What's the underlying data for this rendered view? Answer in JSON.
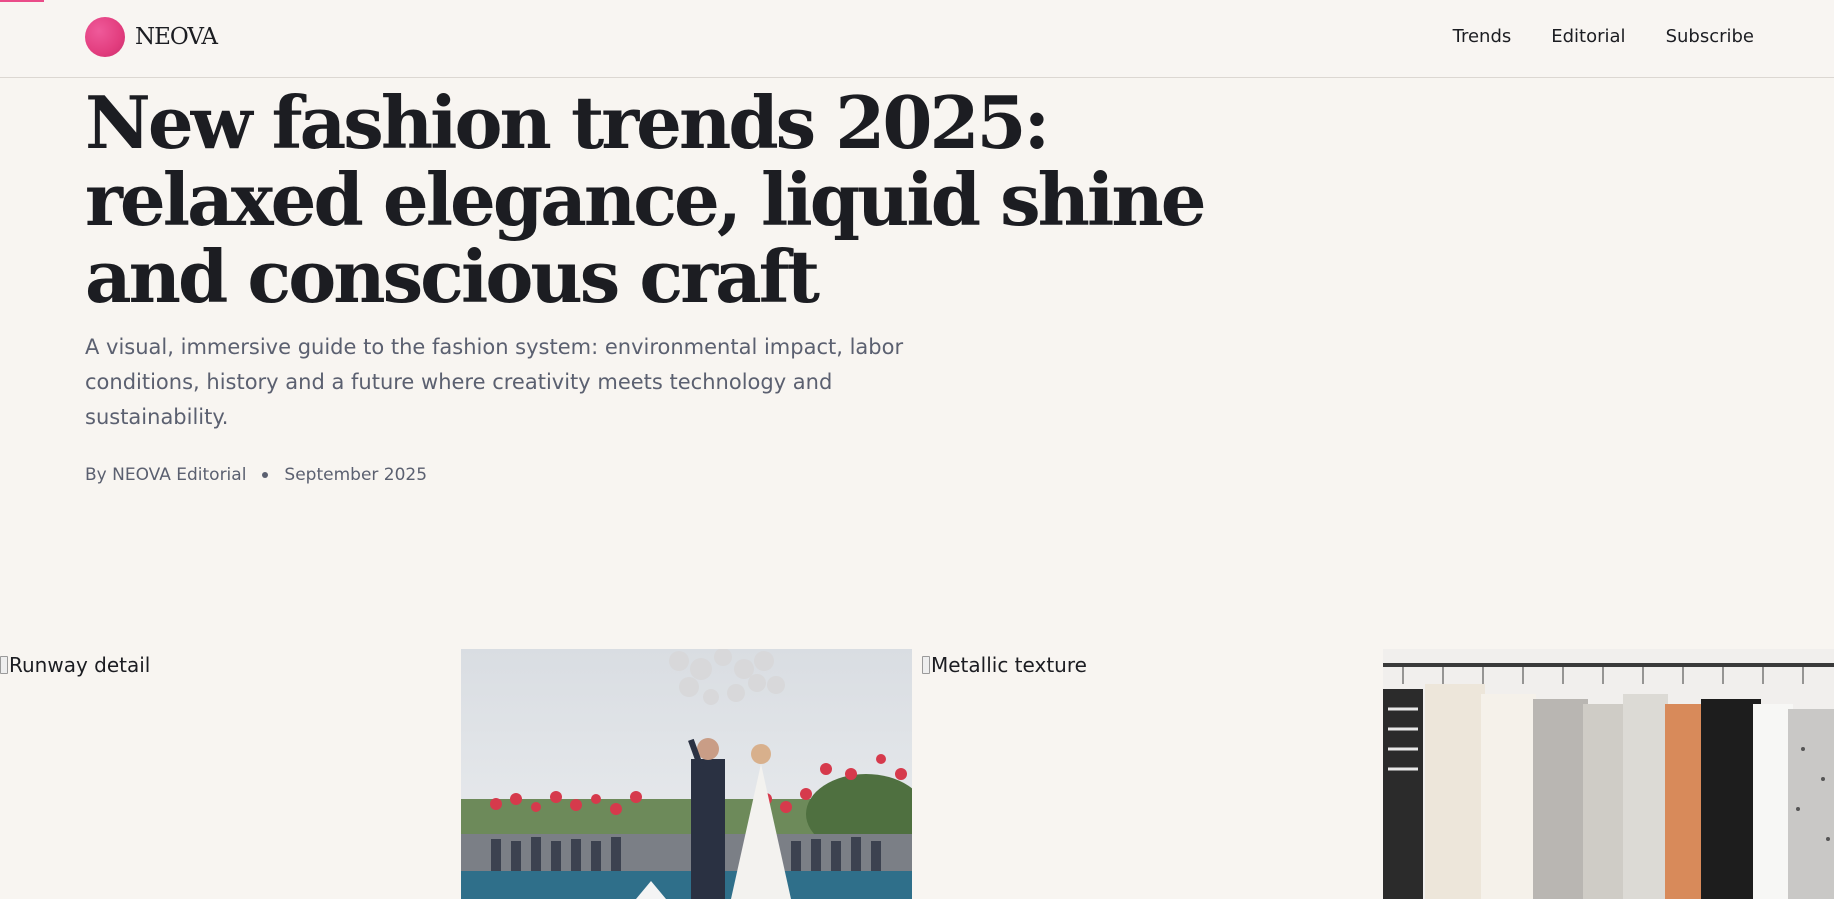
{
  "brand": {
    "name": "NEOVA",
    "accent": "#ea4c89"
  },
  "nav": [
    {
      "label": "Trends"
    },
    {
      "label": "Editorial"
    },
    {
      "label": "Subscribe"
    }
  ],
  "article": {
    "title": "New fashion trends 2025: relaxed elegance, liquid shine and conscious craft",
    "subtitle": "A visual, immersive guide to the fashion system: environmental impact, labor conditions, history and a future where creativity meets technology and sustainability.",
    "author": "By NEOVA Editorial",
    "date": "September 2025"
  },
  "gallery": [
    {
      "alt": "Runway detail",
      "status": "broken"
    },
    {
      "alt": "",
      "status": "loaded",
      "subject": "wedding-balloons-photo"
    },
    {
      "alt": "Metallic texture",
      "status": "broken"
    },
    {
      "alt": "",
      "status": "loaded",
      "subject": "clothing-rack-photo"
    }
  ],
  "colors": {
    "background": "#f8f5f1",
    "text": "#1c1d22",
    "muted": "#5b6070"
  }
}
